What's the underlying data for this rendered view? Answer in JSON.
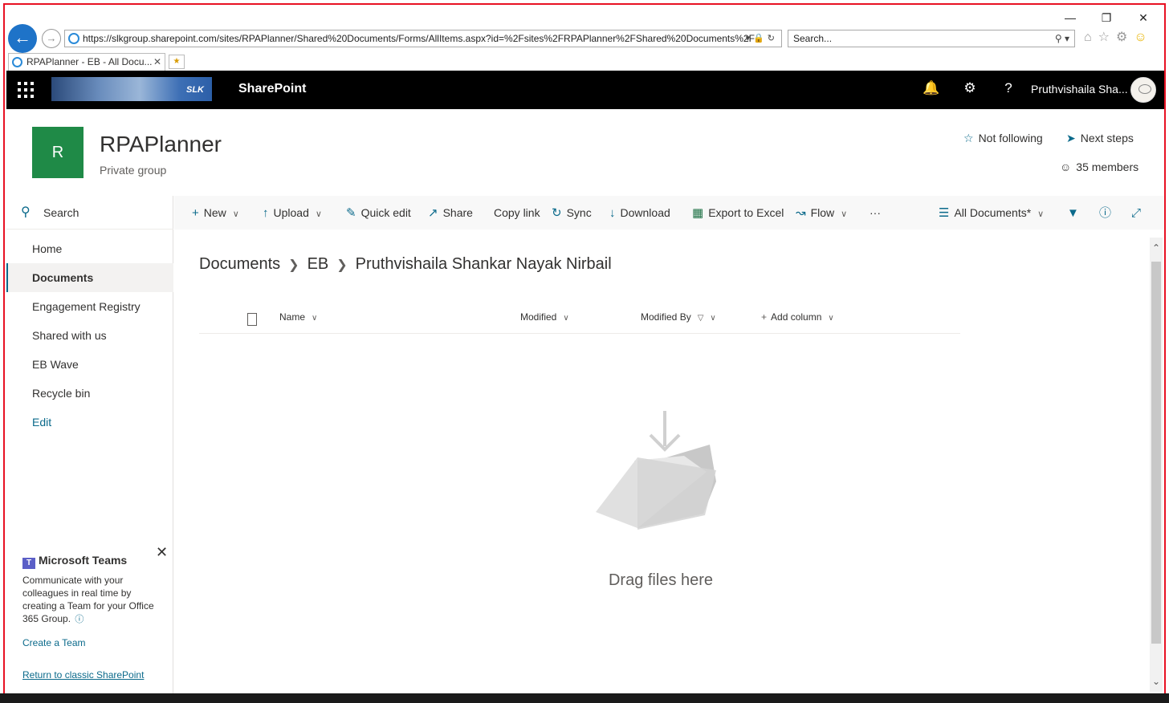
{
  "browser": {
    "url": "https://slkgroup.sharepoint.com/sites/RPAPlanner/Shared%20Documents/Forms/AllItems.aspx?id=%2Fsites%2FRPAPlanner%2FShared%20Documents%2F",
    "search_placeholder": "Search...",
    "tab_title": "RPAPlanner - EB - All Docu...",
    "minimize": "—",
    "restore": "❐",
    "close": "✕",
    "tab_close": "✕"
  },
  "suite": {
    "app_name": "SharePoint",
    "logo_text": "SLK",
    "user_name": "Pruthvishaila Sha...",
    "icons": [
      "bell-icon",
      "gear-icon",
      "help-icon"
    ]
  },
  "site": {
    "logo_letter": "R",
    "title": "RPAPlanner",
    "subtitle": "Private group",
    "follow_label": "Not following",
    "next_steps_label": "Next steps",
    "members_label": "35 members"
  },
  "nav": {
    "search_label": "Search",
    "items": [
      {
        "label": "Home"
      },
      {
        "label": "Documents"
      },
      {
        "label": "Engagement Registry"
      },
      {
        "label": "Shared with us"
      },
      {
        "label": "EB Wave"
      },
      {
        "label": "Recycle bin"
      }
    ],
    "edit_label": "Edit",
    "teams": {
      "title": "Microsoft Teams",
      "body": "Communicate with your colleagues in real time by creating a Team for your Office 365 Group.",
      "link": "Create a Team"
    },
    "classic_link": "Return to classic SharePoint"
  },
  "commands": {
    "new": "New",
    "upload": "Upload",
    "quick_edit": "Quick edit",
    "share": "Share",
    "copy_link": "Copy link",
    "sync": "Sync",
    "download": "Download",
    "export": "Export to Excel",
    "flow": "Flow",
    "more": "···",
    "view": "All Documents*"
  },
  "breadcrumb": [
    "Documents",
    "EB",
    "Pruthvishaila Shankar Nayak Nirbail"
  ],
  "columns": {
    "name": "Name",
    "modified": "Modified",
    "modified_by": "Modified By",
    "add_column": "Add column"
  },
  "empty_state": "Drag files here"
}
